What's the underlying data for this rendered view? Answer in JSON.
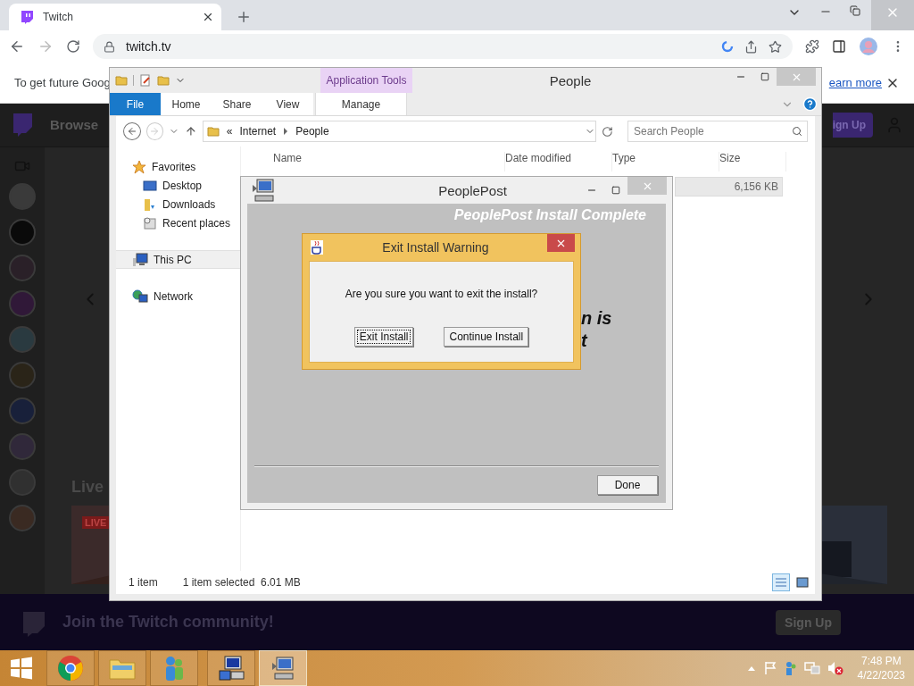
{
  "browser": {
    "tab": {
      "title": "Twitch"
    },
    "url": "twitch.tv",
    "infobar": {
      "text": "To get future Goog",
      "link": "earn more"
    }
  },
  "twitch": {
    "browse": "Browse",
    "sign_up_top": "ign Up",
    "section_title": "Live",
    "live_badge": "LIVE",
    "banner": {
      "text": "Join the Twitch community!",
      "button": "Sign Up"
    }
  },
  "explorer": {
    "title": "People",
    "context_header": "Application Tools",
    "ribbon_tabs": [
      {
        "label": "File",
        "kind": "file"
      },
      {
        "label": "Home",
        "kind": "tab"
      },
      {
        "label": "Share",
        "kind": "tab"
      },
      {
        "label": "View",
        "kind": "tab"
      },
      {
        "label": "Manage",
        "kind": "context"
      }
    ],
    "address": {
      "prefix": "«",
      "crumbs": [
        "Internet",
        "People"
      ]
    },
    "search": {
      "placeholder": "Search People"
    },
    "nav": [
      {
        "label": "Favorites",
        "kind": "star",
        "selected": false,
        "children": [
          {
            "label": "Desktop",
            "kind": "desktop",
            "selected": false
          },
          {
            "label": "Downloads",
            "kind": "downloads",
            "selected": false
          },
          {
            "label": "Recent places",
            "kind": "recent",
            "selected": false
          }
        ]
      },
      {
        "label": "This PC",
        "kind": "pc",
        "selected": true
      },
      {
        "label": "Network",
        "kind": "network",
        "selected": false
      }
    ],
    "columns": [
      "Name",
      "Date modified",
      "Type",
      "Size"
    ],
    "rows": [
      {
        "size": "6,156 KB",
        "selected": true
      }
    ],
    "status": {
      "count": "1 item",
      "selection": "1 item selected  6.01 MB"
    }
  },
  "installer": {
    "title": "PeoplePost",
    "heading": "PeoplePost Install Complete",
    "message_fragments": [
      "n is",
      "t"
    ],
    "done": "Done"
  },
  "dialog": {
    "title": "Exit Install Warning",
    "message": "Are you sure you want to exit the install?",
    "buttons": [
      {
        "label": "Exit Install",
        "focused": true
      },
      {
        "label": "Continue Install",
        "focused": false
      }
    ]
  },
  "taskbar": {
    "apps": [
      {
        "kind": "chrome",
        "active": false
      },
      {
        "kind": "explorer",
        "active": false
      },
      {
        "kind": "people",
        "active": false
      },
      {
        "kind": "installer",
        "active": false
      },
      {
        "kind": "pc",
        "active": true
      }
    ],
    "time": "7:48 PM",
    "date": "4/22/2023"
  }
}
